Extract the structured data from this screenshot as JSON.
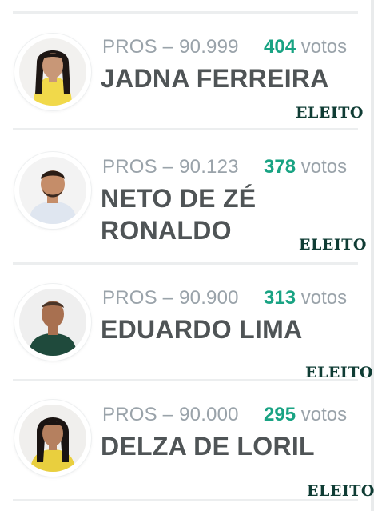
{
  "candidates": [
    {
      "party_line": "PROS – 90.999",
      "votes_count": "404",
      "votes_label": "votos",
      "name": "JADNA FERREIRA",
      "status": "ELEITO"
    },
    {
      "party_line": "PROS – 90.123",
      "votes_count": "378",
      "votes_label": "votos",
      "name_line1": "NETO DE ZÉ",
      "name_line2": "RONALDO",
      "status": "ELEITO"
    },
    {
      "party_line": "PROS – 90.900",
      "votes_count": "313",
      "votes_label": "votos",
      "name": "EDUARDO LIMA",
      "status": "ELEITO"
    },
    {
      "party_line": "PROS – 90.000",
      "votes_count": "295",
      "votes_label": "votos",
      "name": "DELZA DE LORIL",
      "status": "ELEITO"
    }
  ],
  "colors": {
    "votes_accent": "#19a383",
    "status_text": "#0f3c34",
    "party_text": "#9aa3aa",
    "name_text": "#4f5456"
  }
}
